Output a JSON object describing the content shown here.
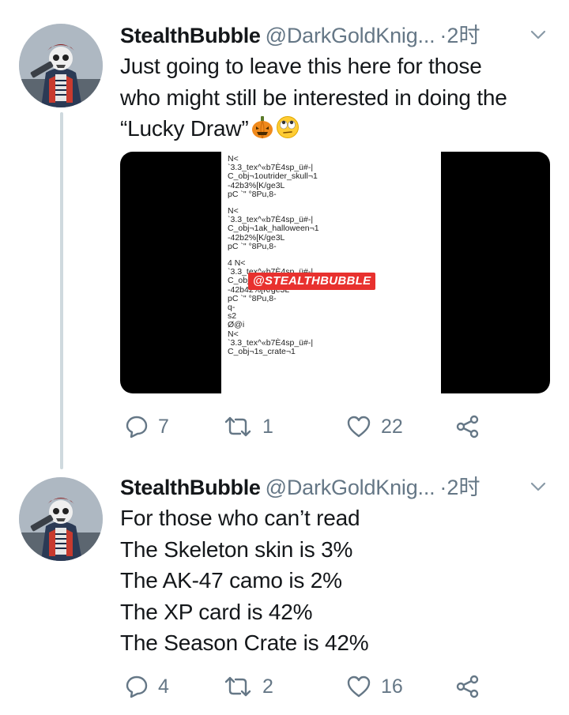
{
  "tweets": [
    {
      "display_name": "StealthBubble",
      "handle": "@DarkGoldKnig...",
      "separator": "·",
      "time": "2时",
      "text_lines": [
        "Just going to leave this here for those",
        "who might still be interested in doing the",
        "“Lucky Draw”"
      ],
      "emojis": [
        "jack-o-lantern-emoji",
        "rolling-eyes-emoji"
      ],
      "media": {
        "watermark": "@STEALTHBUBBLE",
        "lines": [
          "N<",
          "`3.3_tex^«b7È4sp_ü#-|",
          "C_obj¬1outrider_skull¬1",
          "-42b3%[K/ge3L",
          "pC `\" °8Pu,8-",
          "",
          "N<",
          "`3.3_tex^«b7È4sp_ü#-|",
          "C_obj¬1ak_halloween¬1",
          "-42b2%[K/ge3L",
          "pC `\" °8Pu,8-",
          "",
          "4 N<",
          "`3.3_tex^«b7È4sp_ü#-|",
          "C_obj¬1epic_xp¬1",
          "-42b42%[K/ge3L",
          "pC `\" °8Pu,8-",
          "q-",
          "s2",
          "Ø@i",
          "N<",
          "`3.3_tex^«b7È4sp_ü#-|",
          "C_obj¬1s_crate¬1"
        ]
      },
      "counts": {
        "replies": "7",
        "retweets": "1",
        "likes": "22"
      }
    },
    {
      "display_name": "StealthBubble",
      "handle": "@DarkGoldKnig...",
      "separator": "·",
      "time": "2时",
      "text_lines": [
        "For those who can’t read",
        "The Skeleton skin is 3%",
        "The AK-47 camo is 2%",
        "The XP card is 42%",
        "The Season Crate is 42%"
      ],
      "counts": {
        "replies": "4",
        "retweets": "2",
        "likes": "16"
      }
    }
  ],
  "colors": {
    "text": "#14171a",
    "secondary": "#657786",
    "thread_line": "#cfd9de",
    "watermark_bg": "#e8312e"
  },
  "icons": [
    "reply-icon",
    "retweet-icon",
    "like-icon",
    "share-icon",
    "chevron-down-icon"
  ]
}
